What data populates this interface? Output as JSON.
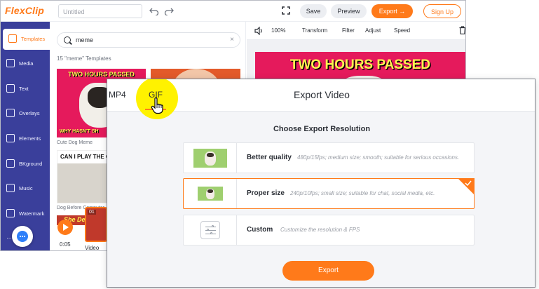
{
  "app": {
    "logo_text": "FlexClip",
    "project_title_placeholder": "Untitled"
  },
  "topbar": {
    "save_label": "Save",
    "preview_label": "Preview",
    "export_label": "Export →",
    "signup_label": "Sign Up"
  },
  "sidebar": {
    "items": [
      {
        "label": "Templates",
        "icon": "templates-icon"
      },
      {
        "label": "Media",
        "icon": "media-icon"
      },
      {
        "label": "Text",
        "icon": "text-icon"
      },
      {
        "label": "Overlays",
        "icon": "overlays-icon"
      },
      {
        "label": "Elements",
        "icon": "elements-icon"
      },
      {
        "label": "BKground",
        "icon": "background-icon"
      },
      {
        "label": "Music",
        "icon": "music-icon"
      },
      {
        "label": "Watermark",
        "icon": "watermark-icon"
      }
    ],
    "more": "…"
  },
  "panel": {
    "search_value": "meme",
    "clear_icon": "×",
    "result_count": "15 \"meme\" Templates",
    "templates": [
      {
        "caption_top": "TWO HOURS PASSED",
        "caption_bottom": "WHY HASN'T SH",
        "label": "Cute Dog Meme"
      },
      {
        "caption_top": "CAN I PLAY THE G",
        "label": "Dog Before Computer"
      },
      {
        "caption_top": "She Demo"
      }
    ],
    "time": "0:05",
    "clip_number": "01",
    "clip_label": "Video"
  },
  "editor_toolbar": {
    "zoom": "100%",
    "transform": "Transform",
    "filter": "Filter",
    "adjust": "Adjust",
    "speed": "Speed"
  },
  "canvas": {
    "caption": "TWO HOURS PASSED"
  },
  "export_dialog": {
    "tabs": [
      "MP4",
      "GIF"
    ],
    "active_tab": "GIF",
    "title": "Export Video",
    "heading": "Choose Export Resolution",
    "options": [
      {
        "name": "Better quality",
        "desc": "480p/15fps; medium size; smooth; suitable for serious occasions.",
        "selected": false
      },
      {
        "name": "Proper size",
        "desc": "240p/10fps; small size; suitable for chat, social media, etc.",
        "selected": true
      },
      {
        "name": "Custom",
        "desc": "Customize the resolution & FPS",
        "selected": false
      }
    ],
    "export_button": "Export"
  },
  "colors": {
    "accent": "#ff7a1a",
    "sidebar": "#3a3f9b",
    "highlight": "#fff200"
  }
}
